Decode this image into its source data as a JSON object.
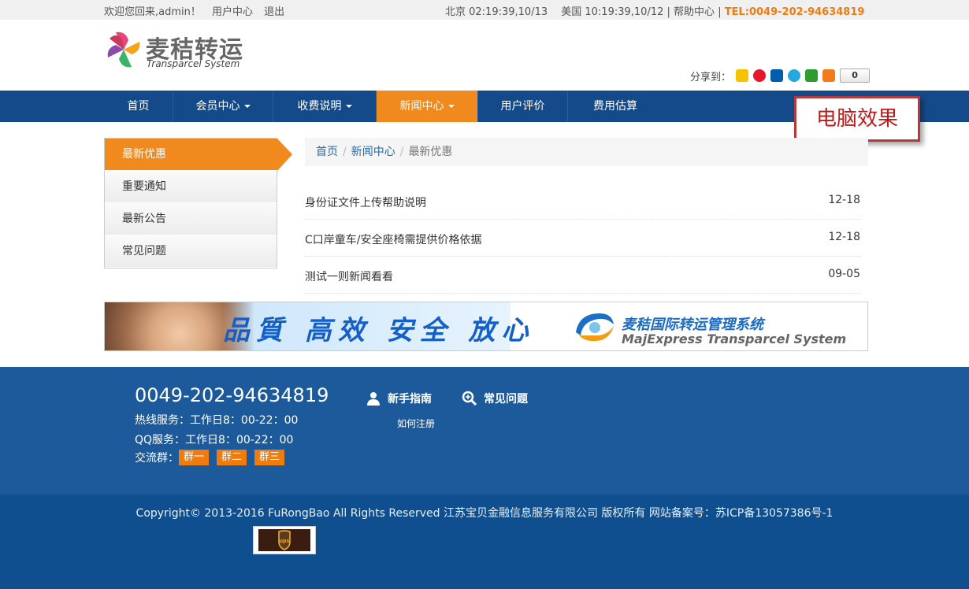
{
  "topbar": {
    "welcome": "欢迎您回来,admin！",
    "user_center": "用户中心",
    "logout": "退出",
    "time_info": "北京 02:19:39,10/13　 美国 10:19:39,10/12",
    "separator": "|",
    "help": "帮助中心",
    "tel": "TEL:0049-202-94634819"
  },
  "header": {
    "logo_cn": "麦秸转运",
    "logo_en": "Transparcel System",
    "share_label": "分享到：",
    "share_count": "0"
  },
  "nav": {
    "items": [
      {
        "label": "首页",
        "dropdown": false,
        "active": false
      },
      {
        "label": "会员中心",
        "dropdown": true,
        "active": false
      },
      {
        "label": "收费说明",
        "dropdown": true,
        "active": false
      },
      {
        "label": "新闻中心",
        "dropdown": true,
        "active": true
      },
      {
        "label": "用户评价",
        "dropdown": false,
        "active": false
      },
      {
        "label": "费用估算",
        "dropdown": false,
        "active": false
      }
    ]
  },
  "badge": "电脑效果",
  "sidebar": {
    "items": [
      "最新优惠",
      "重要通知",
      "最新公告",
      "常见问题"
    ]
  },
  "breadcrumb": {
    "home": "首页",
    "section": "新闻中心",
    "current": "最新优惠",
    "sep": "/"
  },
  "news": [
    {
      "title": "身份证文件上传帮助说明",
      "date": "12-18"
    },
    {
      "title": "C口岸童车/安全座椅需提供价格依据",
      "date": "12-18"
    },
    {
      "title": "测试一则新闻看看",
      "date": "09-05"
    }
  ],
  "banner": {
    "slogan": "品質 高效 安全 放心",
    "brand_cn": "麦秸国际转运管理系统",
    "brand_en": "MajExpress Transparcel System"
  },
  "footer": {
    "phone": "0049-202-94634819",
    "hotline": "热线服务：工作日8：00-22：00",
    "qq": "QQ服务：工作日8：00-22：00",
    "groups_label": "交流群：",
    "groups": [
      "群一",
      "群二",
      "群三"
    ],
    "guide": "新手指南",
    "faq": "常见问题",
    "register": "如何注册",
    "copyright": "Copyright© 2013-2016 FuRongBao All Rights Reserved 江苏宝贝金融信息服务有限公司 版权所有 网站备案号：苏ICP备13057386号-1"
  },
  "colors": {
    "nav_bg": "#154a8a",
    "accent": "#f08a1e",
    "footer_bg": "#1c5a9b",
    "footer_bottom_bg": "#0f4e8f"
  }
}
